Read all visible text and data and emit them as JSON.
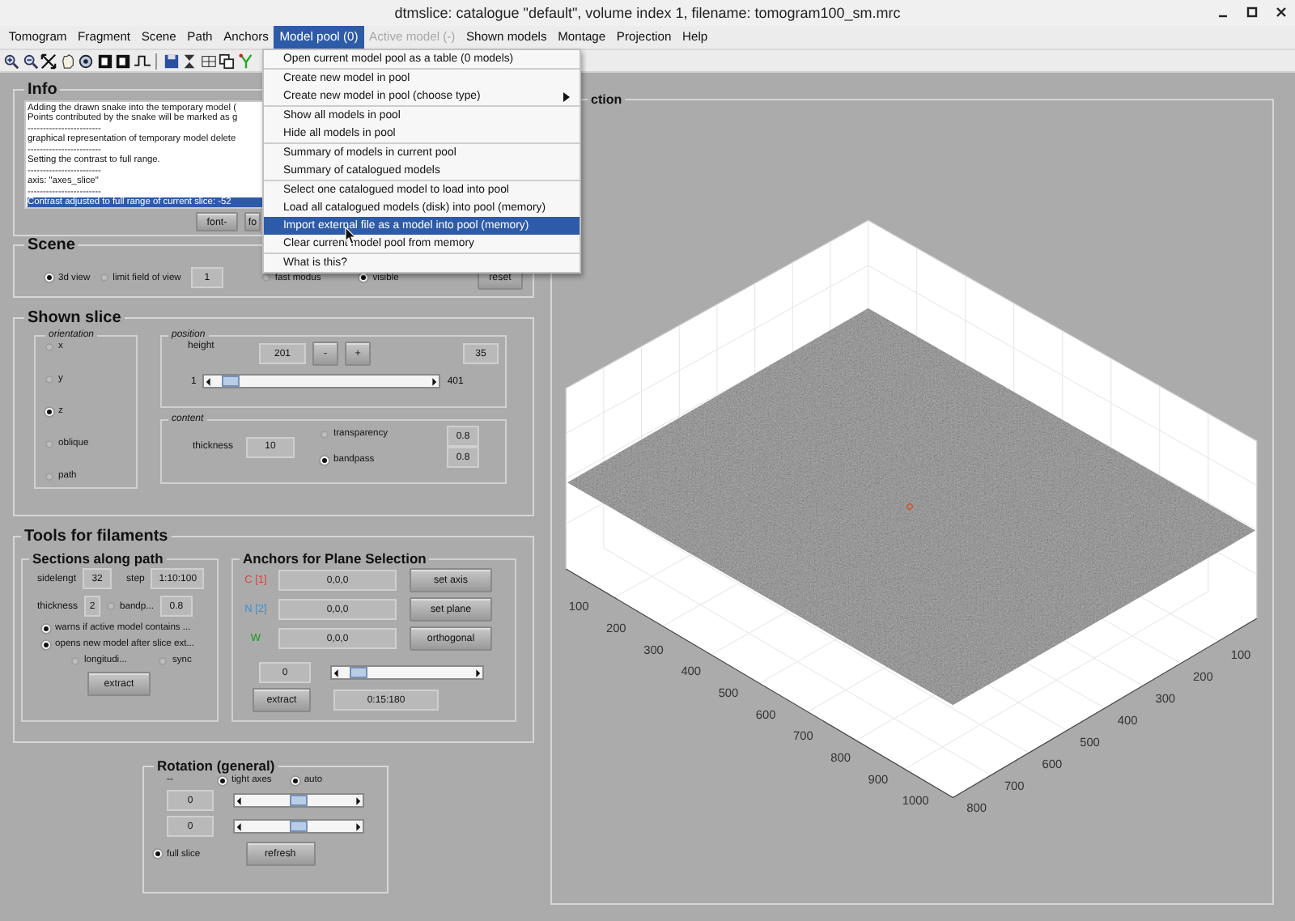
{
  "window": {
    "title": "dtmslice: catalogue \"default\", volume index 1, filename: tomogram100_sm.mrc"
  },
  "menu_bar": [
    {
      "label": "Tomogram",
      "selected": false,
      "disabled": false
    },
    {
      "label": "Fragment",
      "selected": false,
      "disabled": false
    },
    {
      "label": "Scene",
      "selected": false,
      "disabled": false
    },
    {
      "label": "Path",
      "selected": false,
      "disabled": false
    },
    {
      "label": "Anchors",
      "selected": false,
      "disabled": false
    },
    {
      "label": "Model pool (0)",
      "selected": true,
      "disabled": false
    },
    {
      "label": "Active model (-)",
      "selected": false,
      "disabled": true
    },
    {
      "label": "Shown models",
      "selected": false,
      "disabled": false
    },
    {
      "label": "Montage",
      "selected": false,
      "disabled": false
    },
    {
      "label": "Projection",
      "selected": false,
      "disabled": false
    },
    {
      "label": "Help",
      "selected": false,
      "disabled": false
    }
  ],
  "dropdown": {
    "groups": [
      [
        {
          "label": "Open current model pool as a table (0 models)",
          "selected": false,
          "submenu": false
        }
      ],
      [
        {
          "label": "Create new model in pool",
          "selected": false,
          "submenu": false
        },
        {
          "label": "Create new model in pool (choose type)",
          "selected": false,
          "submenu": true
        }
      ],
      [
        {
          "label": "Show all models in pool",
          "selected": false,
          "submenu": false
        },
        {
          "label": "Hide all models in pool",
          "selected": false,
          "submenu": false
        }
      ],
      [
        {
          "label": "Summary of models in current pool",
          "selected": false,
          "submenu": false
        },
        {
          "label": "Summary of catalogued models",
          "selected": false,
          "submenu": false
        }
      ],
      [
        {
          "label": "Select one catalogued model to load into pool",
          "selected": false,
          "submenu": false
        },
        {
          "label": "Load all catalogued models (disk) into pool (memory)",
          "selected": false,
          "submenu": false
        },
        {
          "label": "Import external file as a model into pool (memory)",
          "selected": true,
          "submenu": false
        },
        {
          "label": "Clear current model pool from memory",
          "selected": false,
          "submenu": false
        }
      ],
      [
        {
          "label": "What is this?",
          "selected": false,
          "submenu": false
        }
      ]
    ]
  },
  "info": {
    "title": "Info",
    "log": [
      {
        "text": "Adding the drawn snake into the temporary model (",
        "selected": false
      },
      {
        "text": "Points contributed by the snake will be marked as g",
        "selected": false
      },
      {
        "text": "------------------------",
        "selected": false
      },
      {
        "text": "graphical representation of temporary model delete",
        "selected": false
      },
      {
        "text": "------------------------",
        "selected": false
      },
      {
        "text": "Setting the contrast to full range.",
        "selected": false
      },
      {
        "text": "------------------------",
        "selected": false
      },
      {
        "text": "axis: \"axes_slice\"",
        "selected": false
      },
      {
        "text": "------------------------",
        "selected": false
      },
      {
        "text": "Contrast adjusted to full range of current slice: -52",
        "selected": true
      }
    ],
    "buttons": [
      "font-",
      "fo"
    ]
  },
  "scene": {
    "title": "Scene",
    "view_3d": {
      "label": "3d view",
      "checked": true
    },
    "limit_fov": {
      "label": "limit field of view",
      "checked": false
    },
    "fov_value": "1",
    "fast_modus": {
      "label": "fast modus",
      "checked": false
    },
    "visible": {
      "label": "visible",
      "checked": true
    },
    "reset_button": "reset"
  },
  "shown_slice": {
    "title": "Shown slice",
    "orientation": {
      "title": "orientation",
      "options": [
        {
          "label": "x",
          "selected": false
        },
        {
          "label": "y",
          "selected": false
        },
        {
          "label": "z",
          "selected": true
        },
        {
          "label": "oblique",
          "selected": false
        },
        {
          "label": "path",
          "selected": false
        }
      ]
    },
    "position": {
      "title": "position",
      "height_label": "height",
      "height_value": "201",
      "minus_button": "-",
      "plus_button": "+",
      "slice_value": "35",
      "min_label": "1",
      "max_label": "401",
      "slider": {
        "level": 0.04
      }
    },
    "content": {
      "title": "content",
      "thickness_label": "thickness",
      "thickness_value": "10",
      "transparency": {
        "label": "transparency",
        "checked": false,
        "value": "0.8"
      },
      "bandpass": {
        "label": "bandpass",
        "checked": true,
        "value": "0.8"
      }
    }
  },
  "tools": {
    "title": "Tools for filaments",
    "sections": {
      "title": "Sections along path",
      "sidelength_label": "sidelengt",
      "sidelength_value": "32",
      "step_label": "step",
      "step_value": "1:10:100",
      "thickness_label": "thickness",
      "thickness_value": "2",
      "bandpass": {
        "label": "bandp...",
        "checked": false,
        "value": "0.8"
      },
      "options": [
        {
          "label": "warns if active model contains ...",
          "checked": true
        },
        {
          "label": "opens new model after slice ext...",
          "checked": true
        }
      ],
      "longitudinal": {
        "label": "longitudi...",
        "checked": false
      },
      "sync": {
        "label": "sync",
        "checked": false
      },
      "extract_button": "extract"
    },
    "anchors": {
      "title": "Anchors for Plane Selection",
      "rows": [
        {
          "label": "C [1]",
          "color": "#e03c3c",
          "value": "0,0,0",
          "button": "set axis"
        },
        {
          "label": "N [2]",
          "color": "#3a8fd8",
          "value": "0,0,0",
          "button": "set plane"
        },
        {
          "label": "W",
          "color": "#1a9a1a",
          "value": "0,0,0",
          "button": "orthogonal"
        }
      ],
      "angle_value": "0",
      "slider": {
        "level": 0.07
      },
      "extract_button": "extract",
      "range_value": "0:15:180"
    }
  },
  "rotation": {
    "title": "Rotation (general)",
    "dash_label": "--",
    "tight_axes": {
      "label": "tight axes",
      "checked": true
    },
    "auto": {
      "label": "auto",
      "checked": true
    },
    "axes": [
      {
        "value": "0",
        "level": 0.5
      },
      {
        "value": "0",
        "level": 0.5
      }
    ],
    "full_slice": {
      "label": "full slice",
      "checked": true
    },
    "refresh_button": "refresh"
  },
  "projection": {
    "title": "ction",
    "x_tick_labels": [
      "100",
      "200",
      "300",
      "400",
      "500",
      "600",
      "700",
      "800",
      "900",
      "1000"
    ],
    "y_tick_labels": [
      "100",
      "200",
      "300",
      "400",
      "500",
      "600",
      "700",
      "800"
    ]
  }
}
